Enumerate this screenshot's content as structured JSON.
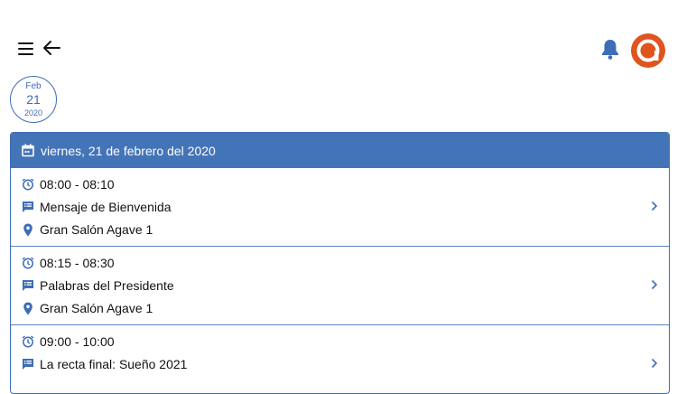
{
  "header": {
    "menu_icon": "hamburger-icon",
    "back_icon": "arrow-left-icon",
    "bell_icon": "bell-icon",
    "avatar_icon": "at-logo-icon"
  },
  "date_badge": {
    "month": "Feb",
    "day": "21",
    "year": "2020"
  },
  "day_card": {
    "title": "viernes, 21 de febrero del 2020",
    "accent": "#4474b8",
    "events": [
      {
        "time": "08:00 - 08:10",
        "title": "Mensaje de Bienvenida",
        "location": "Gran Salón Agave 1"
      },
      {
        "time": "08:15 - 08:30",
        "title": "Palabras del Presidente",
        "location": "Gran Salón Agave 1"
      },
      {
        "time": "09:00 - 10:00",
        "title": "La recta final: Sueño 2021",
        "location": ""
      }
    ]
  },
  "colors": {
    "avatar": "#e0541e",
    "icon_blue": "#3d6db5"
  }
}
